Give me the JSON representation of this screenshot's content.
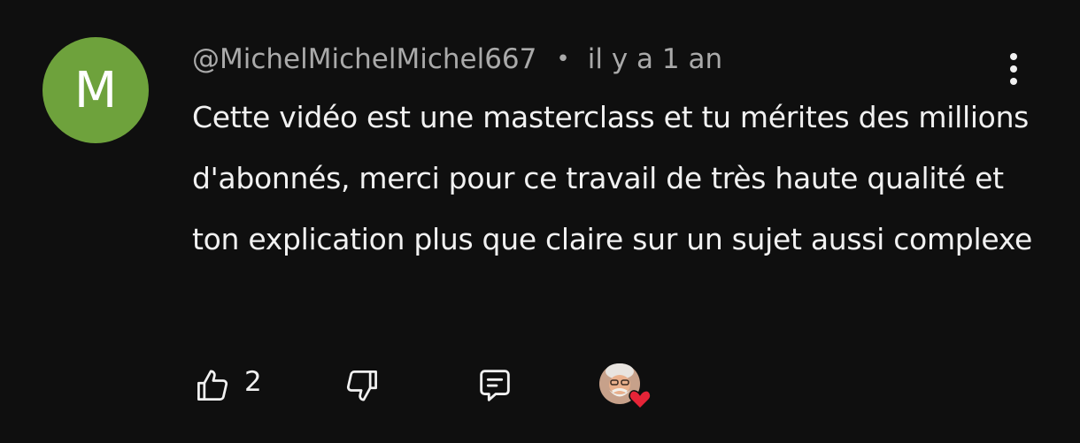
{
  "comment": {
    "avatar_letter": "M",
    "avatar_color": "#6ea23c",
    "author": "@MichelMichelMichel667",
    "separator": "•",
    "time": "il y a 1 an",
    "text": "Cette vidéo est une masterclass et tu mérites des millions d'abonnés, merci pour ce travail de très haute qualité et ton explication plus que claire sur un sujet aussi complexe",
    "like_count": "2",
    "heart_color": "#e62437",
    "icons": {
      "like": "thumbs-up-icon",
      "dislike": "thumbs-down-icon",
      "reply": "comment-icon",
      "menu": "more-vertical-icon",
      "creator_heart": "creator-heart-badge"
    }
  }
}
